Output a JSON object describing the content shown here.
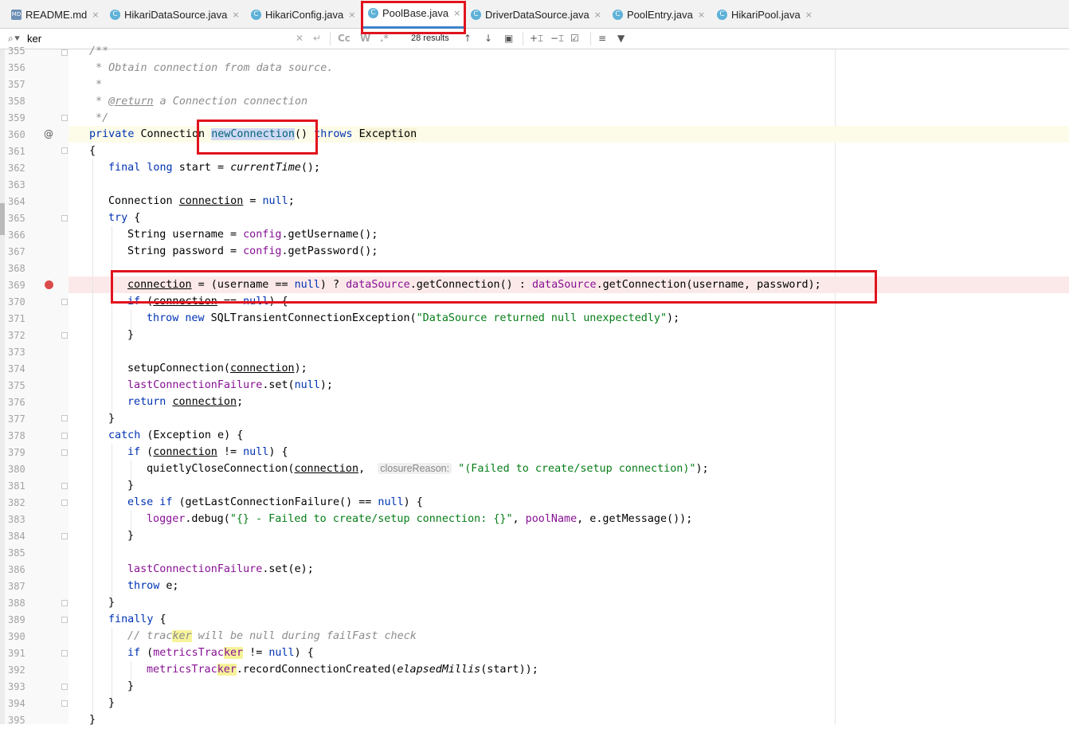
{
  "tabs": [
    {
      "label": "README.md",
      "icon": "markdown-file-icon",
      "icon_text": "MD"
    },
    {
      "label": "HikariDataSource.java",
      "icon": "java-class-icon",
      "icon_text": "C"
    },
    {
      "label": "HikariConfig.java",
      "icon": "java-class-icon",
      "icon_text": "C"
    },
    {
      "label": "PoolBase.java",
      "icon": "java-class-icon",
      "icon_text": "C",
      "active": true
    },
    {
      "label": "DriverDataSource.java",
      "icon": "java-class-icon",
      "icon_text": "C"
    },
    {
      "label": "PoolEntry.java",
      "icon": "java-class-icon",
      "icon_text": "C"
    },
    {
      "label": "HikariPool.java",
      "icon": "java-class-icon",
      "icon_text": "C"
    }
  ],
  "tab_close_glyph": "×",
  "search": {
    "query": "ker",
    "results": "28 results",
    "match_case_label": "Cc",
    "words_label": "W",
    "regex_label": ".*"
  },
  "lines": [
    "355",
    "356",
    "357",
    "358",
    "359",
    "360",
    "361",
    "362",
    "363",
    "364",
    "365",
    "366",
    "367",
    "368",
    "369",
    "370",
    "371",
    "372",
    "373",
    "374",
    "375",
    "376",
    "377",
    "378",
    "379",
    "380",
    "381",
    "382",
    "383",
    "384",
    "385",
    "386",
    "387",
    "388",
    "389",
    "390",
    "391",
    "392",
    "393",
    "394",
    "395"
  ],
  "code": {
    "l355": "/**",
    "l356": " * Obtain connection from data source.",
    "l357": " *",
    "l358a": " * ",
    "l358b": "@return",
    "l358c": " a Connection connection",
    "l359": " */",
    "l360_kw": "private ",
    "l360_type": "Connection ",
    "l360_name": "newConnection",
    "l360_parens": "() ",
    "l360_throws": "throws ",
    "l360_exc": "Exception",
    "l361": "{",
    "l362_kw": "final long ",
    "l362_var": "start = ",
    "l362_call": "currentTime",
    "l362_end": "();",
    "l364_type": "Connection ",
    "l364_var": "connection",
    "l364_eq": " = ",
    "l364_null": "null",
    "l364_end": ";",
    "l365_kw": "try",
    "l365_end": " {",
    "l366_a": "String username = ",
    "l366_fld": "config",
    "l366_b": ".getUsername();",
    "l367_a": "String password = ",
    "l367_fld": "config",
    "l367_b": ".getPassword();",
    "l369_var": "connection",
    "l369_a": " = (username == ",
    "l369_null": "null",
    "l369_b": ") ? ",
    "l369_fld1": "dataSource",
    "l369_c": ".getConnection() : ",
    "l369_fld2": "dataSource",
    "l369_d": ".getConnection(username, password);",
    "l370_kw": "if",
    "l370_a": " (",
    "l370_var": "connection",
    "l370_b": " == ",
    "l370_null": "null",
    "l370_c": ") {",
    "l371_kw": "throw new ",
    "l371_a": "SQLTransientConnectionException(",
    "l371_str": "\"DataSource returned null unexpectedly\"",
    "l371_b": ");",
    "l372": "}",
    "l374_a": "setupConnection(",
    "l374_var": "connection",
    "l374_b": ");",
    "l375_fld": "lastConnectionFailure",
    "l375_a": ".set(",
    "l375_null": "null",
    "l375_b": ");",
    "l376_kw": "return ",
    "l376_var": "connection",
    "l376_b": ";",
    "l377": "}",
    "l378_kw": "catch",
    "l378_a": " (Exception e) {",
    "l379_kw": "if",
    "l379_a": " (",
    "l379_var": "connection",
    "l379_b": " != ",
    "l379_null": "null",
    "l379_c": ") {",
    "l380_a": "quietlyCloseConnection(",
    "l380_var": "connection",
    "l380_b": ",  ",
    "l380_hint": "closureReason:",
    "l380_str": " \"(Failed to create/setup connection)\"",
    "l380_c": ");",
    "l381": "}",
    "l382_kw1": "else if",
    "l382_a": " (getLastConnectionFailure() == ",
    "l382_null": "null",
    "l382_b": ") {",
    "l383_fld": "logger",
    "l383_a": ".debug(",
    "l383_str": "\"{} - Failed to create/setup connection: {}\"",
    "l383_b": ", ",
    "l383_fld2": "poolName",
    "l383_c": ", e.getMessage());",
    "l384": "}",
    "l386_fld": "lastConnectionFailure",
    "l386_a": ".set(e);",
    "l387_kw": "throw",
    "l387_a": " e;",
    "l388": "}",
    "l389_kw": "finally",
    "l389_a": " {",
    "l390_a": "// trac",
    "l390_hl": "ker",
    "l390_b": " will be null during failFast check",
    "l391_kw": "if",
    "l391_a": " (",
    "l391_fld": "metricsTrac",
    "l391_hl": "ker",
    "l391_b": " != ",
    "l391_null": "null",
    "l391_c": ") {",
    "l392_fld": "metricsTrac",
    "l392_hl": "ker",
    "l392_a": ".recordConnectionCreated(",
    "l392_call": "elapsedMillis",
    "l392_b": "(start));",
    "l393": "}",
    "l394": "}",
    "l395": "}"
  },
  "gutter": {
    "override_marker": "@"
  },
  "colors": {
    "highlight_box": "#e0141e",
    "breakpoint": "#db4b4b",
    "breakpoint_line_bg": "#fbe9e9"
  }
}
